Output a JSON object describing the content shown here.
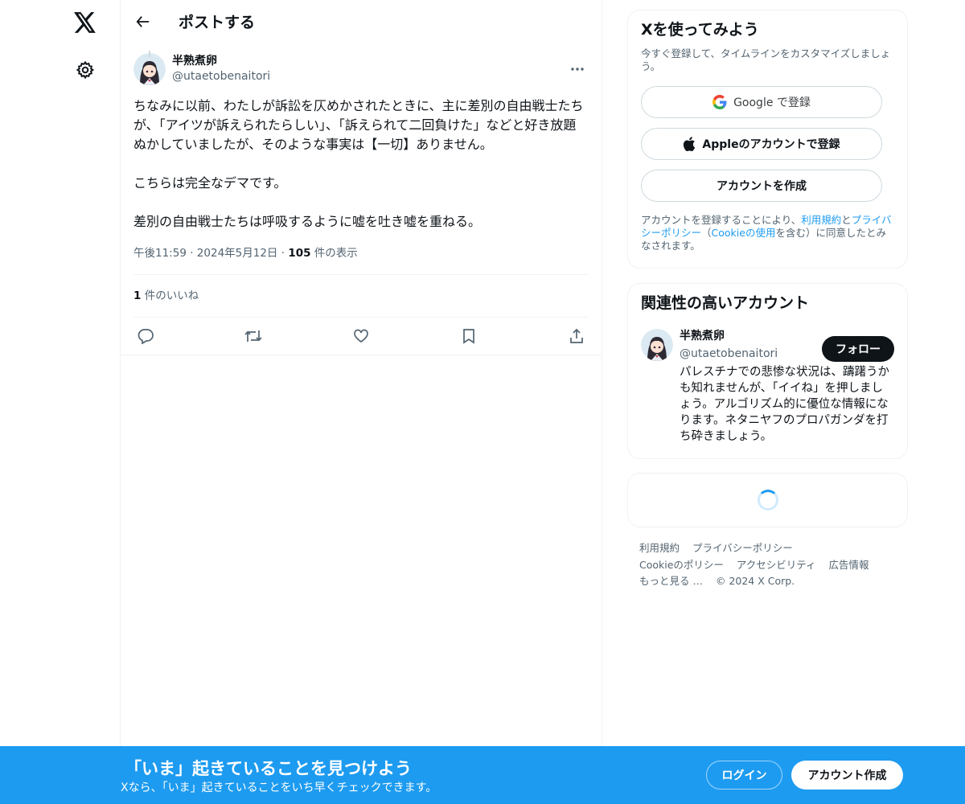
{
  "header": {
    "title": "ポストする"
  },
  "post": {
    "author_name": "半熟煮卵",
    "author_handle": "@utaetobenaitori",
    "text": "ちなみに以前、わたしが訴訟を仄めかされたときに、主に差別の自由戦士たちが、「アイツが訴えられたらしい」、「訴えられて二回負けた」などと好き放題ぬかしていましたが、そのような事実は【一切】ありません。\n\nこちらは完全なデマです。\n\n差別の自由戦士たちは呼吸するように嘘を吐き嘘を重ねる。",
    "time": "午後11:59",
    "sep1": "·",
    "date": "2024年5月12日",
    "sep2": "·",
    "views_count": "105",
    "views_label": "件の表示",
    "likes_count": "1",
    "likes_label": "件のいいね"
  },
  "signup_card": {
    "title": "Xを使ってみよう",
    "subtitle": "今すぐ登録して、タイムラインをカスタマイズしましょう。",
    "google_label": "Google で登録",
    "apple_label": "Appleのアカウントで登録",
    "create_label": "アカウントを作成",
    "terms_prefix": "アカウントを登録することにより、",
    "terms_link": "利用規約",
    "terms_and": "と",
    "privacy_link": "プライバシーポリシー",
    "terms_paren_open": "（",
    "cookie_link": "Cookieの使用",
    "terms_suffix": "を含む）に同意したとみなされます。"
  },
  "related": {
    "title": "関連性の高いアカウント",
    "name": "半熟煮卵",
    "handle": "@utaetobenaitori",
    "bio": "パレスチナでの悲惨な状況は、躊躇うかも知れませんが、「イイね」を押しましょう。アルゴリズム的に優位な情報になります。ネタニヤフのプロパガンダを打ち砕きましょう。",
    "follow_label": "フォロー"
  },
  "footer": {
    "links": [
      "利用規約",
      "プライバシーポリシー",
      "Cookieのポリシー",
      "アクセシビリティ",
      "広告情報",
      "もっと見る …"
    ],
    "copyright": "© 2024 X Corp."
  },
  "banner": {
    "title": "「いま」起きていることを見つけよう",
    "subtitle": "Xなら、「いま」起きていることをいち早くチェックできます。",
    "login_label": "ログイン",
    "signup_label": "アカウント作成"
  },
  "colors": {
    "accent": "#1d9bf0",
    "text": "#0f1419",
    "muted": "#536471",
    "border": "#eff3f4"
  },
  "icons": [
    "x-logo-icon",
    "gear-icon",
    "back-arrow-icon",
    "more-icon",
    "reply-icon",
    "retweet-icon",
    "like-icon",
    "bookmark-icon",
    "share-icon",
    "google-icon",
    "apple-icon",
    "loading-spinner-icon"
  ]
}
